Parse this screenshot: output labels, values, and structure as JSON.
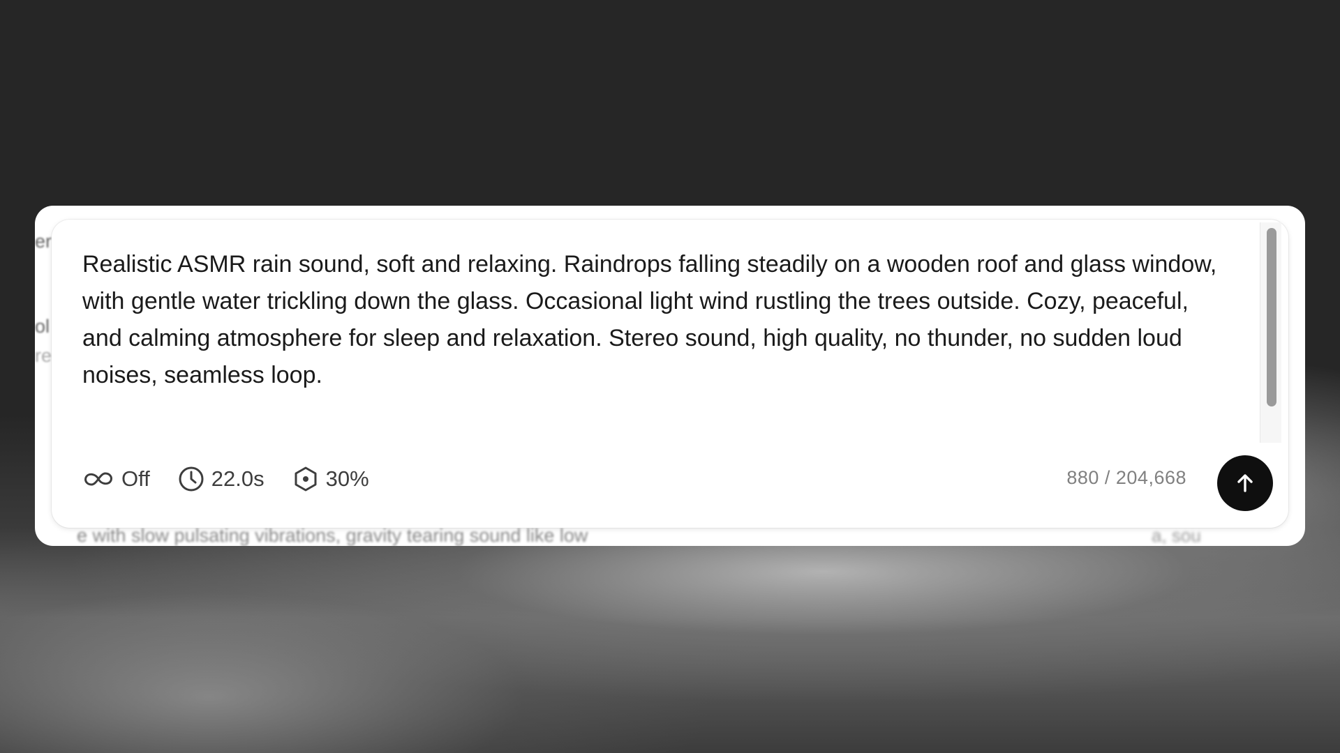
{
  "background": {
    "ghost_top_left": "er",
    "ghost_mid_left_1": "ol",
    "ghost_mid_left_2": "re",
    "ghost_bottom": "e with slow pulsating vibrations, gravity tearing sound like low",
    "ghost_bottom_right": "a, sou"
  },
  "prompt": {
    "text": "Realistic ASMR rain sound, soft and relaxing. Raindrops falling steadily on a wooden roof and glass window, with gentle water trickling down the glass. Occasional light wind rustling the trees outside. Cozy, peaceful, and calming atmosphere for sleep and relaxation. Stereo sound, high quality, no thunder, no sudden loud noises, seamless loop."
  },
  "toolbar": {
    "loop": {
      "icon": "infinity-icon",
      "label": "Off"
    },
    "duration": {
      "icon": "clock-icon",
      "label": "22.0s"
    },
    "influence": {
      "icon": "target-hexagon-icon",
      "label": "30%"
    }
  },
  "counter": {
    "text": "880 / 204,668"
  },
  "send": {
    "icon": "arrow-up-icon"
  },
  "colors": {
    "page_bg": "#262626",
    "card_bg": "#ffffff",
    "text": "#1a1a1a",
    "muted": "#808080",
    "send_bg": "#0f0f0f"
  }
}
